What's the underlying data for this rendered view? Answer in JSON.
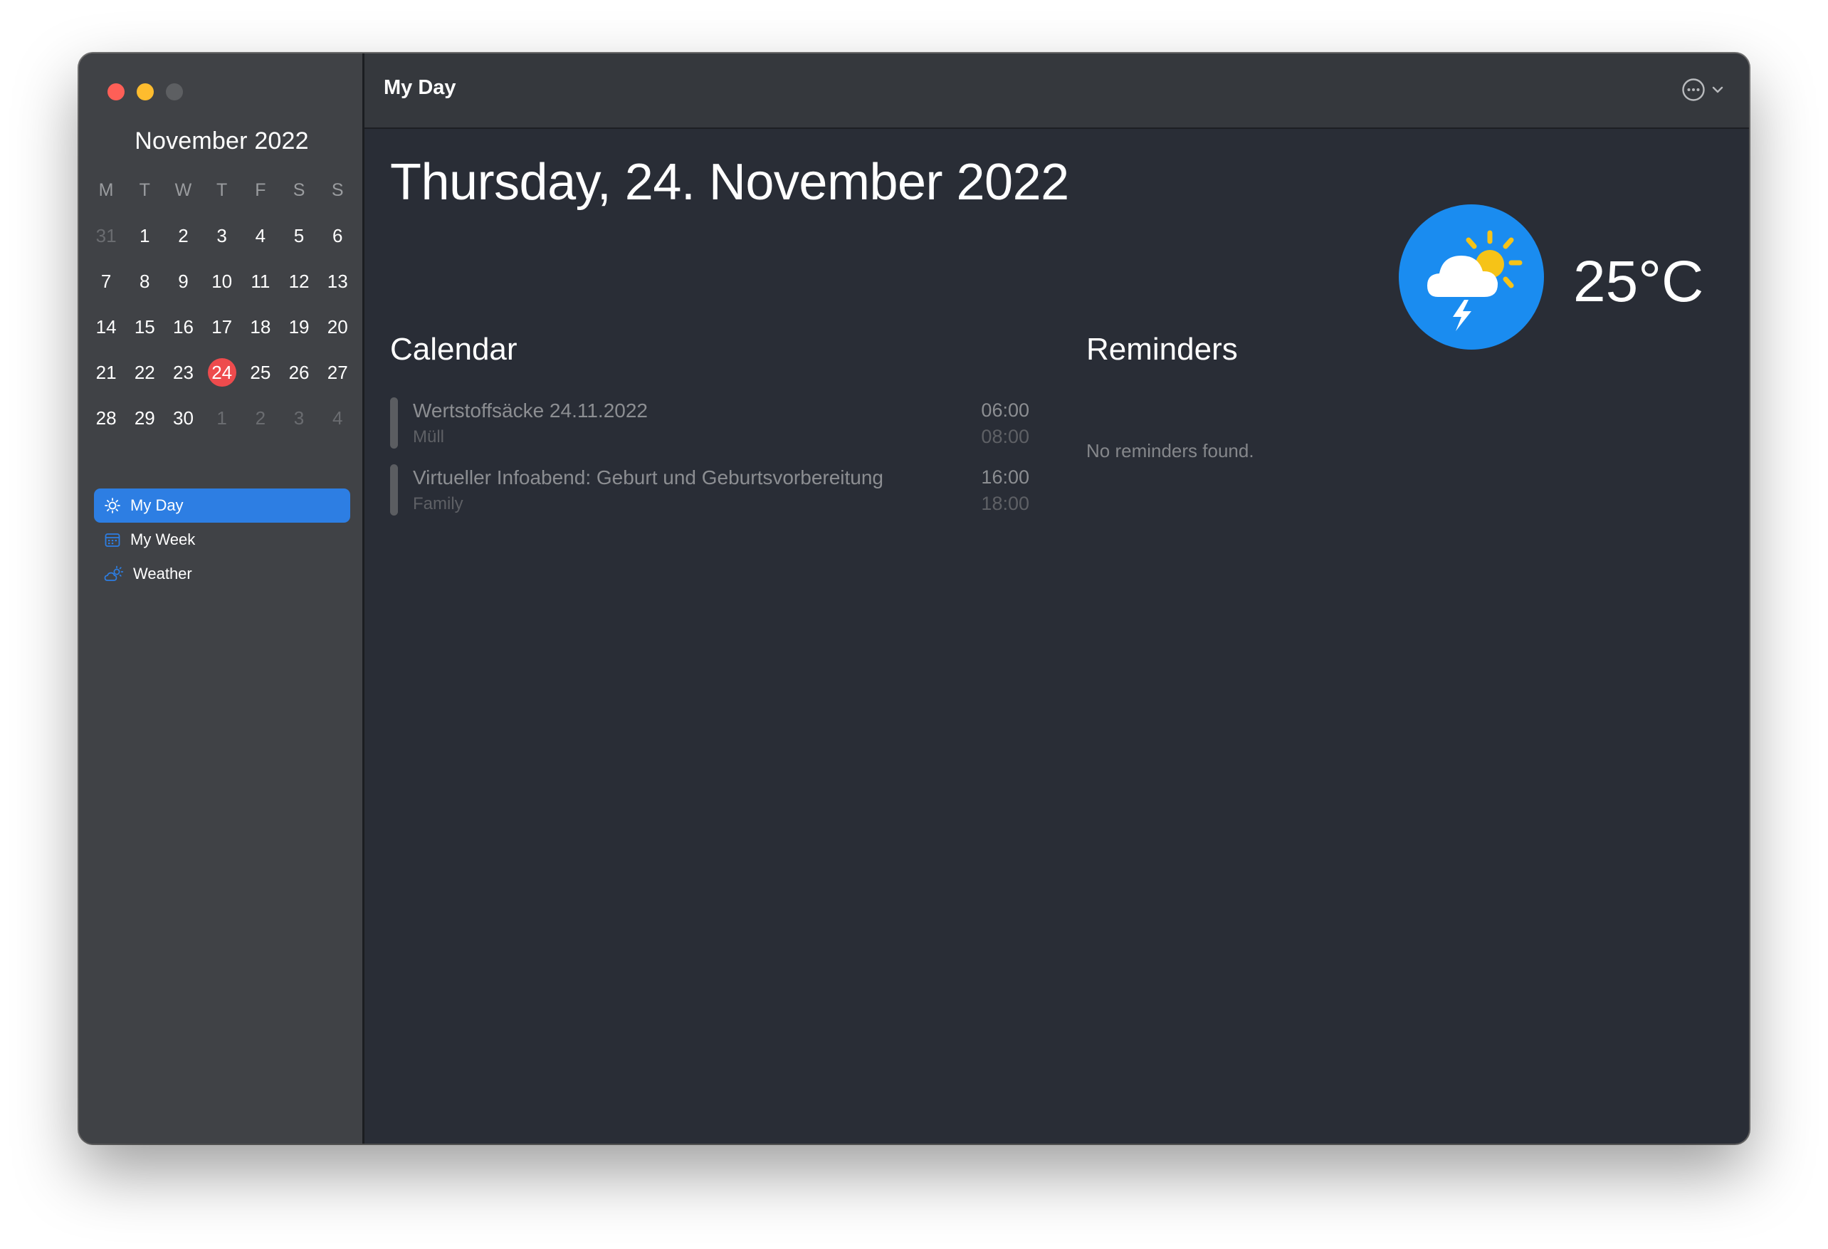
{
  "window": {
    "title": "My Day"
  },
  "sidebar": {
    "month_title": "November 2022",
    "weekdays": [
      "M",
      "T",
      "W",
      "T",
      "F",
      "S",
      "S"
    ],
    "days": [
      {
        "d": "31",
        "muted": true
      },
      {
        "d": "1"
      },
      {
        "d": "2"
      },
      {
        "d": "3"
      },
      {
        "d": "4"
      },
      {
        "d": "5"
      },
      {
        "d": "6"
      },
      {
        "d": "7"
      },
      {
        "d": "8"
      },
      {
        "d": "9"
      },
      {
        "d": "10"
      },
      {
        "d": "11"
      },
      {
        "d": "12"
      },
      {
        "d": "13"
      },
      {
        "d": "14"
      },
      {
        "d": "15"
      },
      {
        "d": "16"
      },
      {
        "d": "17"
      },
      {
        "d": "18"
      },
      {
        "d": "19"
      },
      {
        "d": "20"
      },
      {
        "d": "21"
      },
      {
        "d": "22"
      },
      {
        "d": "23"
      },
      {
        "d": "24",
        "today": true
      },
      {
        "d": "25"
      },
      {
        "d": "26"
      },
      {
        "d": "27"
      },
      {
        "d": "28"
      },
      {
        "d": "29"
      },
      {
        "d": "30"
      },
      {
        "d": "1",
        "muted": true
      },
      {
        "d": "2",
        "muted": true
      },
      {
        "d": "3",
        "muted": true
      },
      {
        "d": "4",
        "muted": true
      }
    ],
    "nav": [
      {
        "label": "My Day",
        "icon": "sun-icon",
        "active": true
      },
      {
        "label": "My Week",
        "icon": "calendar-icon",
        "active": false
      },
      {
        "label": "Weather",
        "icon": "cloud-sun-icon",
        "active": false
      }
    ]
  },
  "main": {
    "date_title": "Thursday, 24. November 2022",
    "weather": {
      "temperature": "25°C",
      "icon": "thunderstorm-sun-icon",
      "accent": "#1a8cf0"
    },
    "calendar_heading": "Calendar",
    "events": [
      {
        "title": "Wertstoffsäcke 24.11.2022",
        "calendar": "Müll",
        "start": "06:00",
        "end": "08:00"
      },
      {
        "title": "Virtueller Infoabend: Geburt und Geburtsvorbereitung",
        "calendar": "Family",
        "start": "16:00",
        "end": "18:00"
      }
    ],
    "reminders_heading": "Reminders",
    "reminders_empty": "No reminders found."
  },
  "colors": {
    "accent": "#2d7ee3",
    "today": "#ee4b4d"
  }
}
